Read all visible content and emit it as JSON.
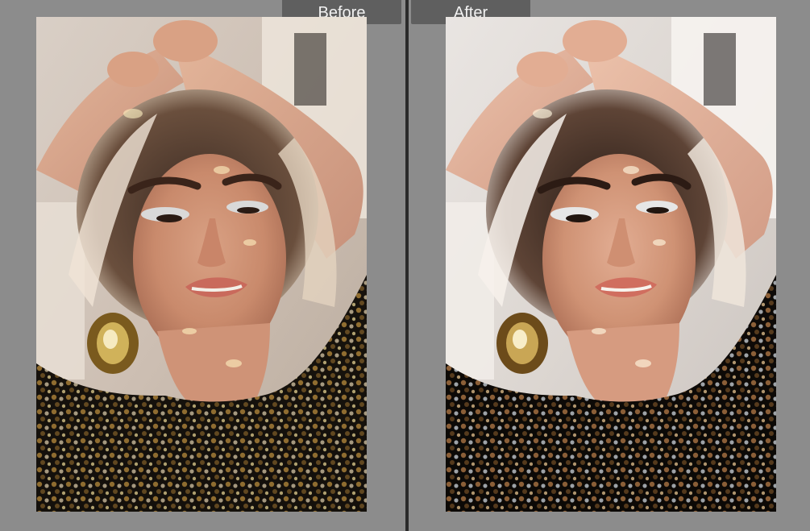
{
  "view": {
    "mode": "before-after",
    "before_label": "Before",
    "after_label": "After"
  },
  "photo": {
    "subject": "portrait-woman-sequin-top",
    "before_variant": "original",
    "after_variant": "edited"
  },
  "colors": {
    "workspace_bg": "#8a8a8a",
    "label_bg": "#5f5f5f",
    "label_text": "#f2f2f2",
    "divider": "#2b2b2b"
  }
}
